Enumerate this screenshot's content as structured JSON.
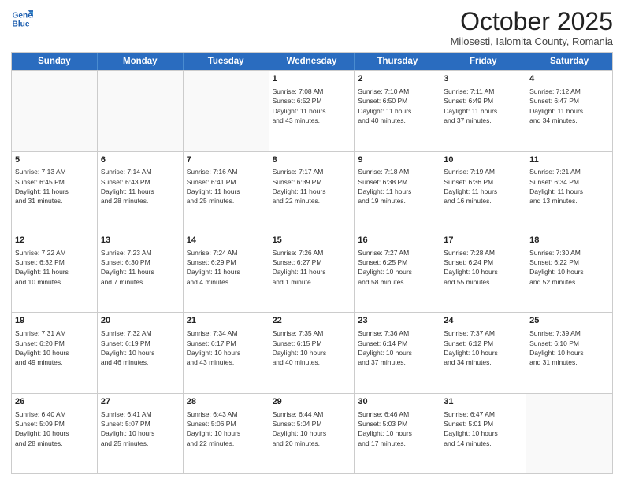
{
  "logo": {
    "line1": "General",
    "line2": "Blue"
  },
  "title": "October 2025",
  "subtitle": "Milosesti, Ialomita County, Romania",
  "header": {
    "days": [
      "Sunday",
      "Monday",
      "Tuesday",
      "Wednesday",
      "Thursday",
      "Friday",
      "Saturday"
    ]
  },
  "weeks": [
    [
      {
        "date": "",
        "info": ""
      },
      {
        "date": "",
        "info": ""
      },
      {
        "date": "",
        "info": ""
      },
      {
        "date": "1",
        "info": "Sunrise: 7:08 AM\nSunset: 6:52 PM\nDaylight: 11 hours\nand 43 minutes."
      },
      {
        "date": "2",
        "info": "Sunrise: 7:10 AM\nSunset: 6:50 PM\nDaylight: 11 hours\nand 40 minutes."
      },
      {
        "date": "3",
        "info": "Sunrise: 7:11 AM\nSunset: 6:49 PM\nDaylight: 11 hours\nand 37 minutes."
      },
      {
        "date": "4",
        "info": "Sunrise: 7:12 AM\nSunset: 6:47 PM\nDaylight: 11 hours\nand 34 minutes."
      }
    ],
    [
      {
        "date": "5",
        "info": "Sunrise: 7:13 AM\nSunset: 6:45 PM\nDaylight: 11 hours\nand 31 minutes."
      },
      {
        "date": "6",
        "info": "Sunrise: 7:14 AM\nSunset: 6:43 PM\nDaylight: 11 hours\nand 28 minutes."
      },
      {
        "date": "7",
        "info": "Sunrise: 7:16 AM\nSunset: 6:41 PM\nDaylight: 11 hours\nand 25 minutes."
      },
      {
        "date": "8",
        "info": "Sunrise: 7:17 AM\nSunset: 6:39 PM\nDaylight: 11 hours\nand 22 minutes."
      },
      {
        "date": "9",
        "info": "Sunrise: 7:18 AM\nSunset: 6:38 PM\nDaylight: 11 hours\nand 19 minutes."
      },
      {
        "date": "10",
        "info": "Sunrise: 7:19 AM\nSunset: 6:36 PM\nDaylight: 11 hours\nand 16 minutes."
      },
      {
        "date": "11",
        "info": "Sunrise: 7:21 AM\nSunset: 6:34 PM\nDaylight: 11 hours\nand 13 minutes."
      }
    ],
    [
      {
        "date": "12",
        "info": "Sunrise: 7:22 AM\nSunset: 6:32 PM\nDaylight: 11 hours\nand 10 minutes."
      },
      {
        "date": "13",
        "info": "Sunrise: 7:23 AM\nSunset: 6:30 PM\nDaylight: 11 hours\nand 7 minutes."
      },
      {
        "date": "14",
        "info": "Sunrise: 7:24 AM\nSunset: 6:29 PM\nDaylight: 11 hours\nand 4 minutes."
      },
      {
        "date": "15",
        "info": "Sunrise: 7:26 AM\nSunset: 6:27 PM\nDaylight: 11 hours\nand 1 minute."
      },
      {
        "date": "16",
        "info": "Sunrise: 7:27 AM\nSunset: 6:25 PM\nDaylight: 10 hours\nand 58 minutes."
      },
      {
        "date": "17",
        "info": "Sunrise: 7:28 AM\nSunset: 6:24 PM\nDaylight: 10 hours\nand 55 minutes."
      },
      {
        "date": "18",
        "info": "Sunrise: 7:30 AM\nSunset: 6:22 PM\nDaylight: 10 hours\nand 52 minutes."
      }
    ],
    [
      {
        "date": "19",
        "info": "Sunrise: 7:31 AM\nSunset: 6:20 PM\nDaylight: 10 hours\nand 49 minutes."
      },
      {
        "date": "20",
        "info": "Sunrise: 7:32 AM\nSunset: 6:19 PM\nDaylight: 10 hours\nand 46 minutes."
      },
      {
        "date": "21",
        "info": "Sunrise: 7:34 AM\nSunset: 6:17 PM\nDaylight: 10 hours\nand 43 minutes."
      },
      {
        "date": "22",
        "info": "Sunrise: 7:35 AM\nSunset: 6:15 PM\nDaylight: 10 hours\nand 40 minutes."
      },
      {
        "date": "23",
        "info": "Sunrise: 7:36 AM\nSunset: 6:14 PM\nDaylight: 10 hours\nand 37 minutes."
      },
      {
        "date": "24",
        "info": "Sunrise: 7:37 AM\nSunset: 6:12 PM\nDaylight: 10 hours\nand 34 minutes."
      },
      {
        "date": "25",
        "info": "Sunrise: 7:39 AM\nSunset: 6:10 PM\nDaylight: 10 hours\nand 31 minutes."
      }
    ],
    [
      {
        "date": "26",
        "info": "Sunrise: 6:40 AM\nSunset: 5:09 PM\nDaylight: 10 hours\nand 28 minutes."
      },
      {
        "date": "27",
        "info": "Sunrise: 6:41 AM\nSunset: 5:07 PM\nDaylight: 10 hours\nand 25 minutes."
      },
      {
        "date": "28",
        "info": "Sunrise: 6:43 AM\nSunset: 5:06 PM\nDaylight: 10 hours\nand 22 minutes."
      },
      {
        "date": "29",
        "info": "Sunrise: 6:44 AM\nSunset: 5:04 PM\nDaylight: 10 hours\nand 20 minutes."
      },
      {
        "date": "30",
        "info": "Sunrise: 6:46 AM\nSunset: 5:03 PM\nDaylight: 10 hours\nand 17 minutes."
      },
      {
        "date": "31",
        "info": "Sunrise: 6:47 AM\nSunset: 5:01 PM\nDaylight: 10 hours\nand 14 minutes."
      },
      {
        "date": "",
        "info": ""
      }
    ]
  ]
}
